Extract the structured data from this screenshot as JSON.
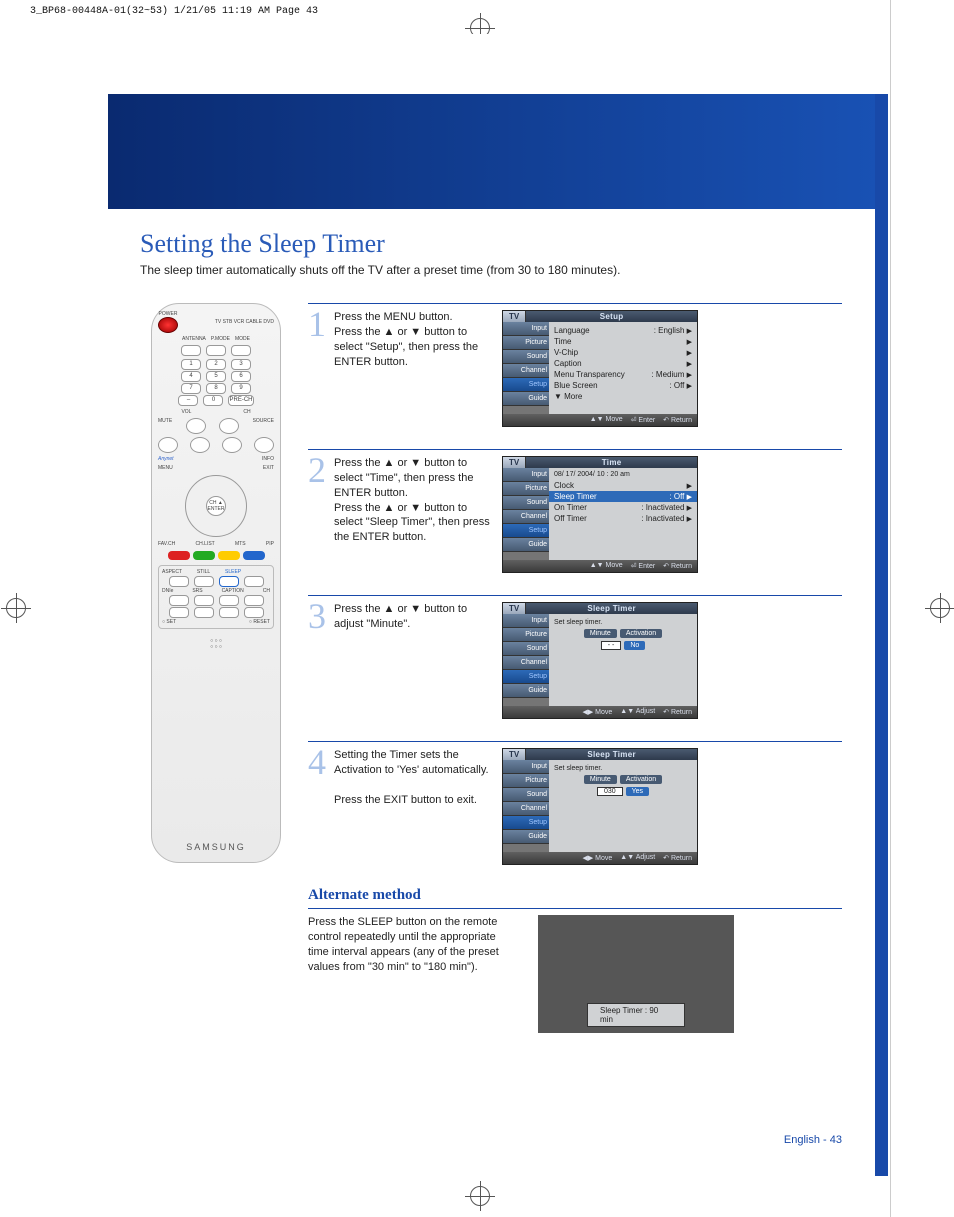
{
  "prepress_header": "3_BP68-00448A-01(32~53)  1/21/05  11:19 AM  Page 43",
  "title": "Setting the Sleep Timer",
  "intro": "The sleep timer automatically shuts off the TV after a preset time (from 30 to 180 minutes).",
  "remote": {
    "power_label": "POWER",
    "mode_labels": "TV  STB  VCR  CABLE  DVD",
    "row_btns": [
      "ANTENNA",
      "P.MODE",
      "MODE"
    ],
    "keypad": [
      [
        "1",
        "2",
        "3"
      ],
      [
        "4",
        "5",
        "6"
      ],
      [
        "7",
        "8",
        "9"
      ],
      [
        "–",
        "0",
        "PRE-CH"
      ]
    ],
    "volch": [
      "VOL",
      "CH"
    ],
    "mute": "MUTE",
    "source": "SOURCE",
    "anynet": "Anynet",
    "info": "INFO",
    "menu": "MENU",
    "exit": "EXIT",
    "enter": "ENTER",
    "pip": "CH ▲",
    "fav_row": [
      "FAV.CH",
      "CH.LIST",
      "MTS",
      "PIP"
    ],
    "misc_row1": [
      "ASPECT",
      "STILL",
      "SLEEP"
    ],
    "misc_row2": [
      "DNIe",
      "SRS",
      "CAPTION",
      "CH"
    ],
    "set_reset": [
      "○ SET",
      "○ RESET"
    ],
    "brand": "SAMSUNG"
  },
  "steps": [
    {
      "num": "1",
      "text": "Press the MENU button.\nPress the ▲ or ▼ button to select \"Setup\", then press the ENTER button.",
      "osd": {
        "title": "Setup",
        "side": [
          "Input",
          "Picture",
          "Sound",
          "Channel",
          "Setup",
          "Guide"
        ],
        "side_sel": 4,
        "lines": [
          {
            "l": "Language",
            "r": ": English",
            "arw": "▶"
          },
          {
            "l": "Time",
            "r": "",
            "arw": "▶"
          },
          {
            "l": "V-Chip",
            "r": "",
            "arw": "▶"
          },
          {
            "l": "Caption",
            "r": "",
            "arw": "▶"
          },
          {
            "l": "Menu Transparency",
            "r": ": Medium",
            "arw": "▶"
          },
          {
            "l": "Blue Screen",
            "r": ": Off",
            "arw": "▶"
          },
          {
            "l": "▼ More",
            "r": "",
            "arw": ""
          }
        ],
        "foot": [
          "▲▼ Move",
          "⏎ Enter",
          "↶ Return"
        ]
      }
    },
    {
      "num": "2",
      "text": "Press the ▲ or ▼ button to select \"Time\", then press the ENTER button.\nPress the ▲ or ▼ button to select \"Sleep Timer\", then press the ENTER button.",
      "osd": {
        "title": "Time",
        "side": [
          "Input",
          "Picture",
          "Sound",
          "Channel",
          "Setup",
          "Guide"
        ],
        "side_sel": 4,
        "header_line": "08/ 17/ 2004/ 10 : 20 am",
        "lines": [
          {
            "l": "Clock",
            "r": "",
            "arw": "▶"
          },
          {
            "l": "Sleep Timer",
            "r": ": Off",
            "arw": "▶",
            "hi": true
          },
          {
            "l": "On Timer",
            "r": ": Inactivated",
            "arw": "▶"
          },
          {
            "l": "Off Timer",
            "r": ": Inactivated",
            "arw": "▶"
          }
        ],
        "foot": [
          "▲▼ Move",
          "⏎ Enter",
          "↶ Return"
        ]
      }
    },
    {
      "num": "3",
      "text": "Press the ▲ or ▼ button to adjust \"Minute\".",
      "osd": {
        "title": "Sleep Timer",
        "side": [
          "Input",
          "Picture",
          "Sound",
          "Channel",
          "Setup",
          "Guide"
        ],
        "side_sel": 4,
        "caption": "Set sleep timer.",
        "labels": [
          "Minute",
          "Activation"
        ],
        "values": [
          "- -",
          "No"
        ],
        "val_hi": 0,
        "foot": [
          "◀▶ Move",
          "▲▼ Adjust",
          "↶ Return"
        ]
      }
    },
    {
      "num": "4",
      "text": "Setting the Timer sets the Activation to 'Yes' automatically.\n\nPress the EXIT button to exit.",
      "osd": {
        "title": "Sleep Timer",
        "side": [
          "Input",
          "Picture",
          "Sound",
          "Channel",
          "Setup",
          "Guide"
        ],
        "side_sel": 4,
        "caption": "Set sleep timer.",
        "labels": [
          "Minute",
          "Activation"
        ],
        "values": [
          "030",
          "Yes"
        ],
        "val_hi": 0,
        "foot": [
          "◀▶ Move",
          "▲▼ Adjust",
          "↶ Return"
        ]
      }
    }
  ],
  "alt": {
    "title": "Alternate method",
    "text": "Press the SLEEP button on the remote control repeatedly until the appropriate time interval appears (any of the preset values from \"30 min\" to \"180 min\").",
    "strip": "Sleep Timer : 90 min"
  },
  "page_number": "English - 43",
  "tv_tab": "TV"
}
